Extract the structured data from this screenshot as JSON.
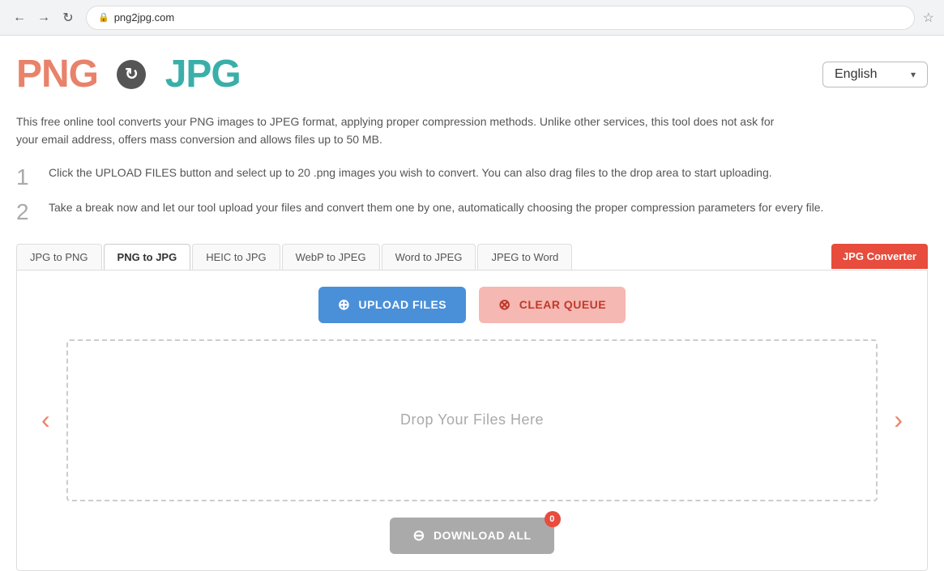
{
  "browser": {
    "back_label": "←",
    "forward_label": "→",
    "refresh_label": "↻",
    "url": "png2jpg.com",
    "star_icon": "☆"
  },
  "header": {
    "logo": {
      "png": "PNG",
      "to": "to",
      "jpg": "JPG"
    },
    "language": {
      "label": "English",
      "chevron": "▾"
    }
  },
  "description": "This free online tool converts your PNG images to JPEG format, applying proper compression methods. Unlike other services, this tool does not ask for your email address, offers mass conversion and allows files up to 50 MB.",
  "steps": [
    {
      "number": "1",
      "text": "Click the UPLOAD FILES button and select up to 20 .png images you wish to convert. You can also drag files to the drop area to start uploading."
    },
    {
      "number": "2",
      "text": "Take a break now and let our tool upload your files and convert them one by one, automatically choosing the proper compression parameters for every file."
    }
  ],
  "tabs": [
    {
      "label": "JPG to PNG",
      "active": false
    },
    {
      "label": "PNG to JPG",
      "active": true
    },
    {
      "label": "HEIC to JPG",
      "active": false
    },
    {
      "label": "WebP to JPEG",
      "active": false
    },
    {
      "label": "Word to JPEG",
      "active": false
    },
    {
      "label": "JPEG to Word",
      "active": false
    }
  ],
  "tab_converter": {
    "label": "JPG Converter"
  },
  "toolbar": {
    "upload_label": "UPLOAD FILES",
    "clear_label": "CLEAR QUEUE"
  },
  "drop_zone": {
    "text": "Drop Your Files Here"
  },
  "nav": {
    "left": "‹",
    "right": "›"
  },
  "download": {
    "label": "DOWNLOAD ALL",
    "badge": "0"
  }
}
